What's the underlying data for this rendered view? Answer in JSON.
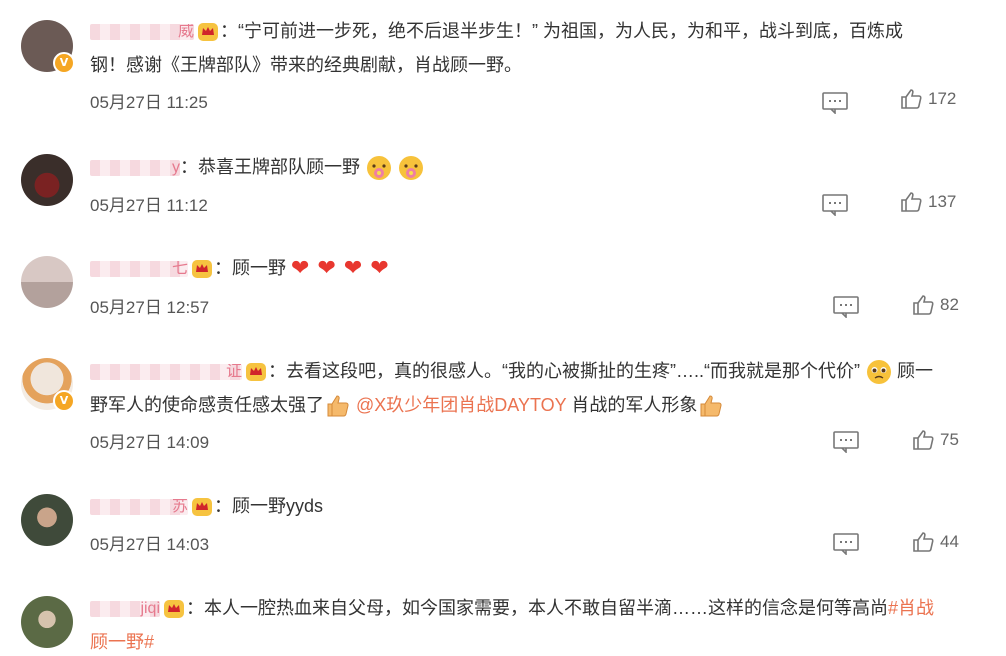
{
  "comments": [
    {
      "username": "威",
      "text": "：“宁可前进一步死，绝不后退半步生！” 为祖国，为人民，为和平，战斗到底，百炼成钢！感谢《王牌部队》带来的经典剧献，肖战顾一野。",
      "line1": "：“宁可前进一步死，绝不后退半步生！” 为祖国，为人民，为和平，战斗到底，百炼成",
      "line2": "钢！感谢《王牌部队》带来的经典剧献，肖战顾一野。",
      "time": "05月27日 11:25",
      "likes": "172",
      "verified": true,
      "crown": true,
      "avatar_color": "#6b5a55"
    },
    {
      "username": "y",
      "line1": "：恭喜王牌部队顾一野",
      "time": "05月27日 11:12",
      "likes": "137",
      "verified": false,
      "crown": false,
      "emoji": [
        "flower-face-emoji",
        "flower-face-emoji"
      ],
      "avatar_color": "#4a3a35"
    },
    {
      "username": "七",
      "line1": "：顾一野",
      "time": "05月27日 12:57",
      "likes": "82",
      "verified": false,
      "crown": true,
      "hearts": [
        "❤",
        "❤",
        "❤",
        "❤"
      ],
      "avatar_color": "#c9b5b0"
    },
    {
      "username": "证",
      "line1": "：去看这段吧，真的很感人。“我的心被撕扯的生疼”…..“而我就是那个代价”",
      "line1_tail": "顾一",
      "line2_a": "野军人的使命感责任感太强了",
      "mention": "@X玖少年团肖战DAYTOY",
      "line2_b": " 肖战的军人形象",
      "time": "05月27日 14:09",
      "likes": "75",
      "verified": true,
      "crown": true,
      "avatar_color": "#e9dccf"
    },
    {
      "username": "苏",
      "line1": "：顾一野yyds",
      "time": "05月27日 14:03",
      "likes": "44",
      "verified": false,
      "crown": true,
      "avatar_color": "#3f4a3a"
    },
    {
      "username": "jiqi",
      "line1": "：本人一腔热血来自父母，如今国家需要，本人不敢自留半滴……这样的信念是何等高尚",
      "hashtag_a": "#肖战",
      "hashtag_b": "顾一野#",
      "verified": false,
      "crown": true,
      "avatar_color": "#6b6a50"
    }
  ],
  "colors": {
    "text": "#333333",
    "meta": "#555555",
    "mention": "#eb7350",
    "heart": "#e8372f",
    "verified_badge": "#f5a623"
  }
}
